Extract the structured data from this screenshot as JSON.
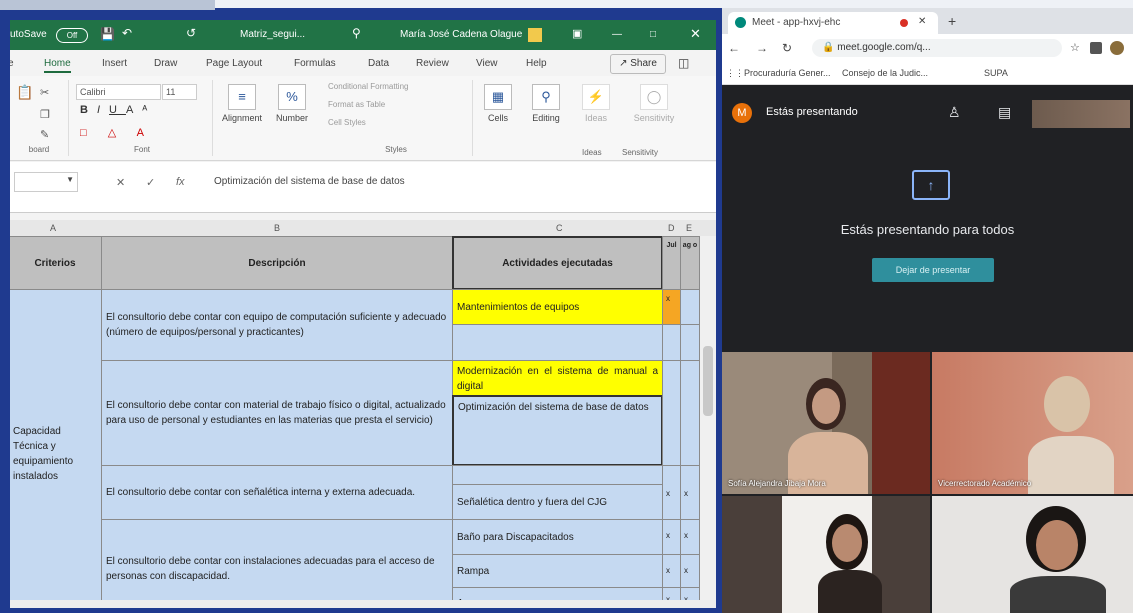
{
  "excel": {
    "autosave_label": "utoSave",
    "autosave_state": "Off",
    "file_name": "Matriz_segui...",
    "user_name": "María José Cadena Olague",
    "tabs": [
      "Home",
      "Insert",
      "Draw",
      "Page Layout",
      "Formulas",
      "Data",
      "Review",
      "View",
      "Help"
    ],
    "active_tab": "Home",
    "share_label": "Share",
    "ribbon": {
      "font_name": "Calibri",
      "font_size": "11",
      "clipboard_label": "board",
      "font_group_label": "Font",
      "alignment_label": "Alignment",
      "number_label": "Number",
      "cond_format_label": "Conditional Formatting",
      "format_table_label": "Format as Table",
      "cell_styles_label": "Cell Styles",
      "styles_group_label": "Styles",
      "cells_label": "Cells",
      "editing_label": "Editing",
      "ideas_label": "Ideas",
      "ideas_group_label": "Ideas",
      "sensitivity_label": "Sensitivity",
      "sensitivity_group_label": "Sensitivity"
    },
    "formula_text": "Optimización del sistema de base de datos",
    "col_headers": [
      "A",
      "B",
      "C",
      "D",
      "E"
    ],
    "table": {
      "headers": {
        "criterios": "Criterios",
        "descripcion": "Descripción",
        "actividades": "Actividades ejecutadas",
        "jul": "Jul",
        "ago": "ag o"
      },
      "criterio_value": "Capacidad Técnica y equipamiento instalados",
      "rows": [
        {
          "descripcion": "El consultorio debe contar con equipo de computación suficiente y adecuado (número de equipos/personal y practicantes)",
          "actividades": [
            "Mantenimientos de equipos"
          ]
        },
        {
          "descripcion": "El consultorio debe contar con material de trabajo físico o digital, actualizado para uso de personal y estudiantes en las materias que presta el servicio)",
          "actividades": [
            "Modernización en el sistema de manual a digital",
            "Optimización del sistema de base de datos"
          ]
        },
        {
          "descripcion": "El consultorio debe contar con señalética interna y externa adecuada.",
          "actividades": [
            "Señalética dentro y fuera del CJG"
          ]
        },
        {
          "descripcion": "El consultorio debe contar con instalaciones adecuadas para el acceso de personas con discapacidad.",
          "actividades": [
            "Baño para Discapacitados",
            "Rampa",
            "Ascensor"
          ]
        }
      ],
      "mark": "x"
    },
    "colors": {
      "header_green": "#217346",
      "highlight_yellow": "#ffff00",
      "row_blue": "#c5d9f1"
    }
  },
  "meet": {
    "tab_title": "Meet - app-hxvj-ehc",
    "url": "meet.google.com/q...",
    "bookmarks": [
      "Procuraduría Gener...",
      "Consejo de la Judic...",
      "SUPA"
    ],
    "presenting_avatar": "M",
    "presenting_label": "Estás presentando",
    "present_title": "Estás presentando para todos",
    "stop_button": "Dejar de presentar",
    "participants": [
      {
        "name": "Sofía Alejandra Jibaja Mora"
      },
      {
        "name": "Vicerrectorado Académico"
      },
      {
        "name": ""
      },
      {
        "name": ""
      }
    ],
    "colors": {
      "present_button": "#2f8f9d",
      "dark_bg": "#202124"
    }
  }
}
